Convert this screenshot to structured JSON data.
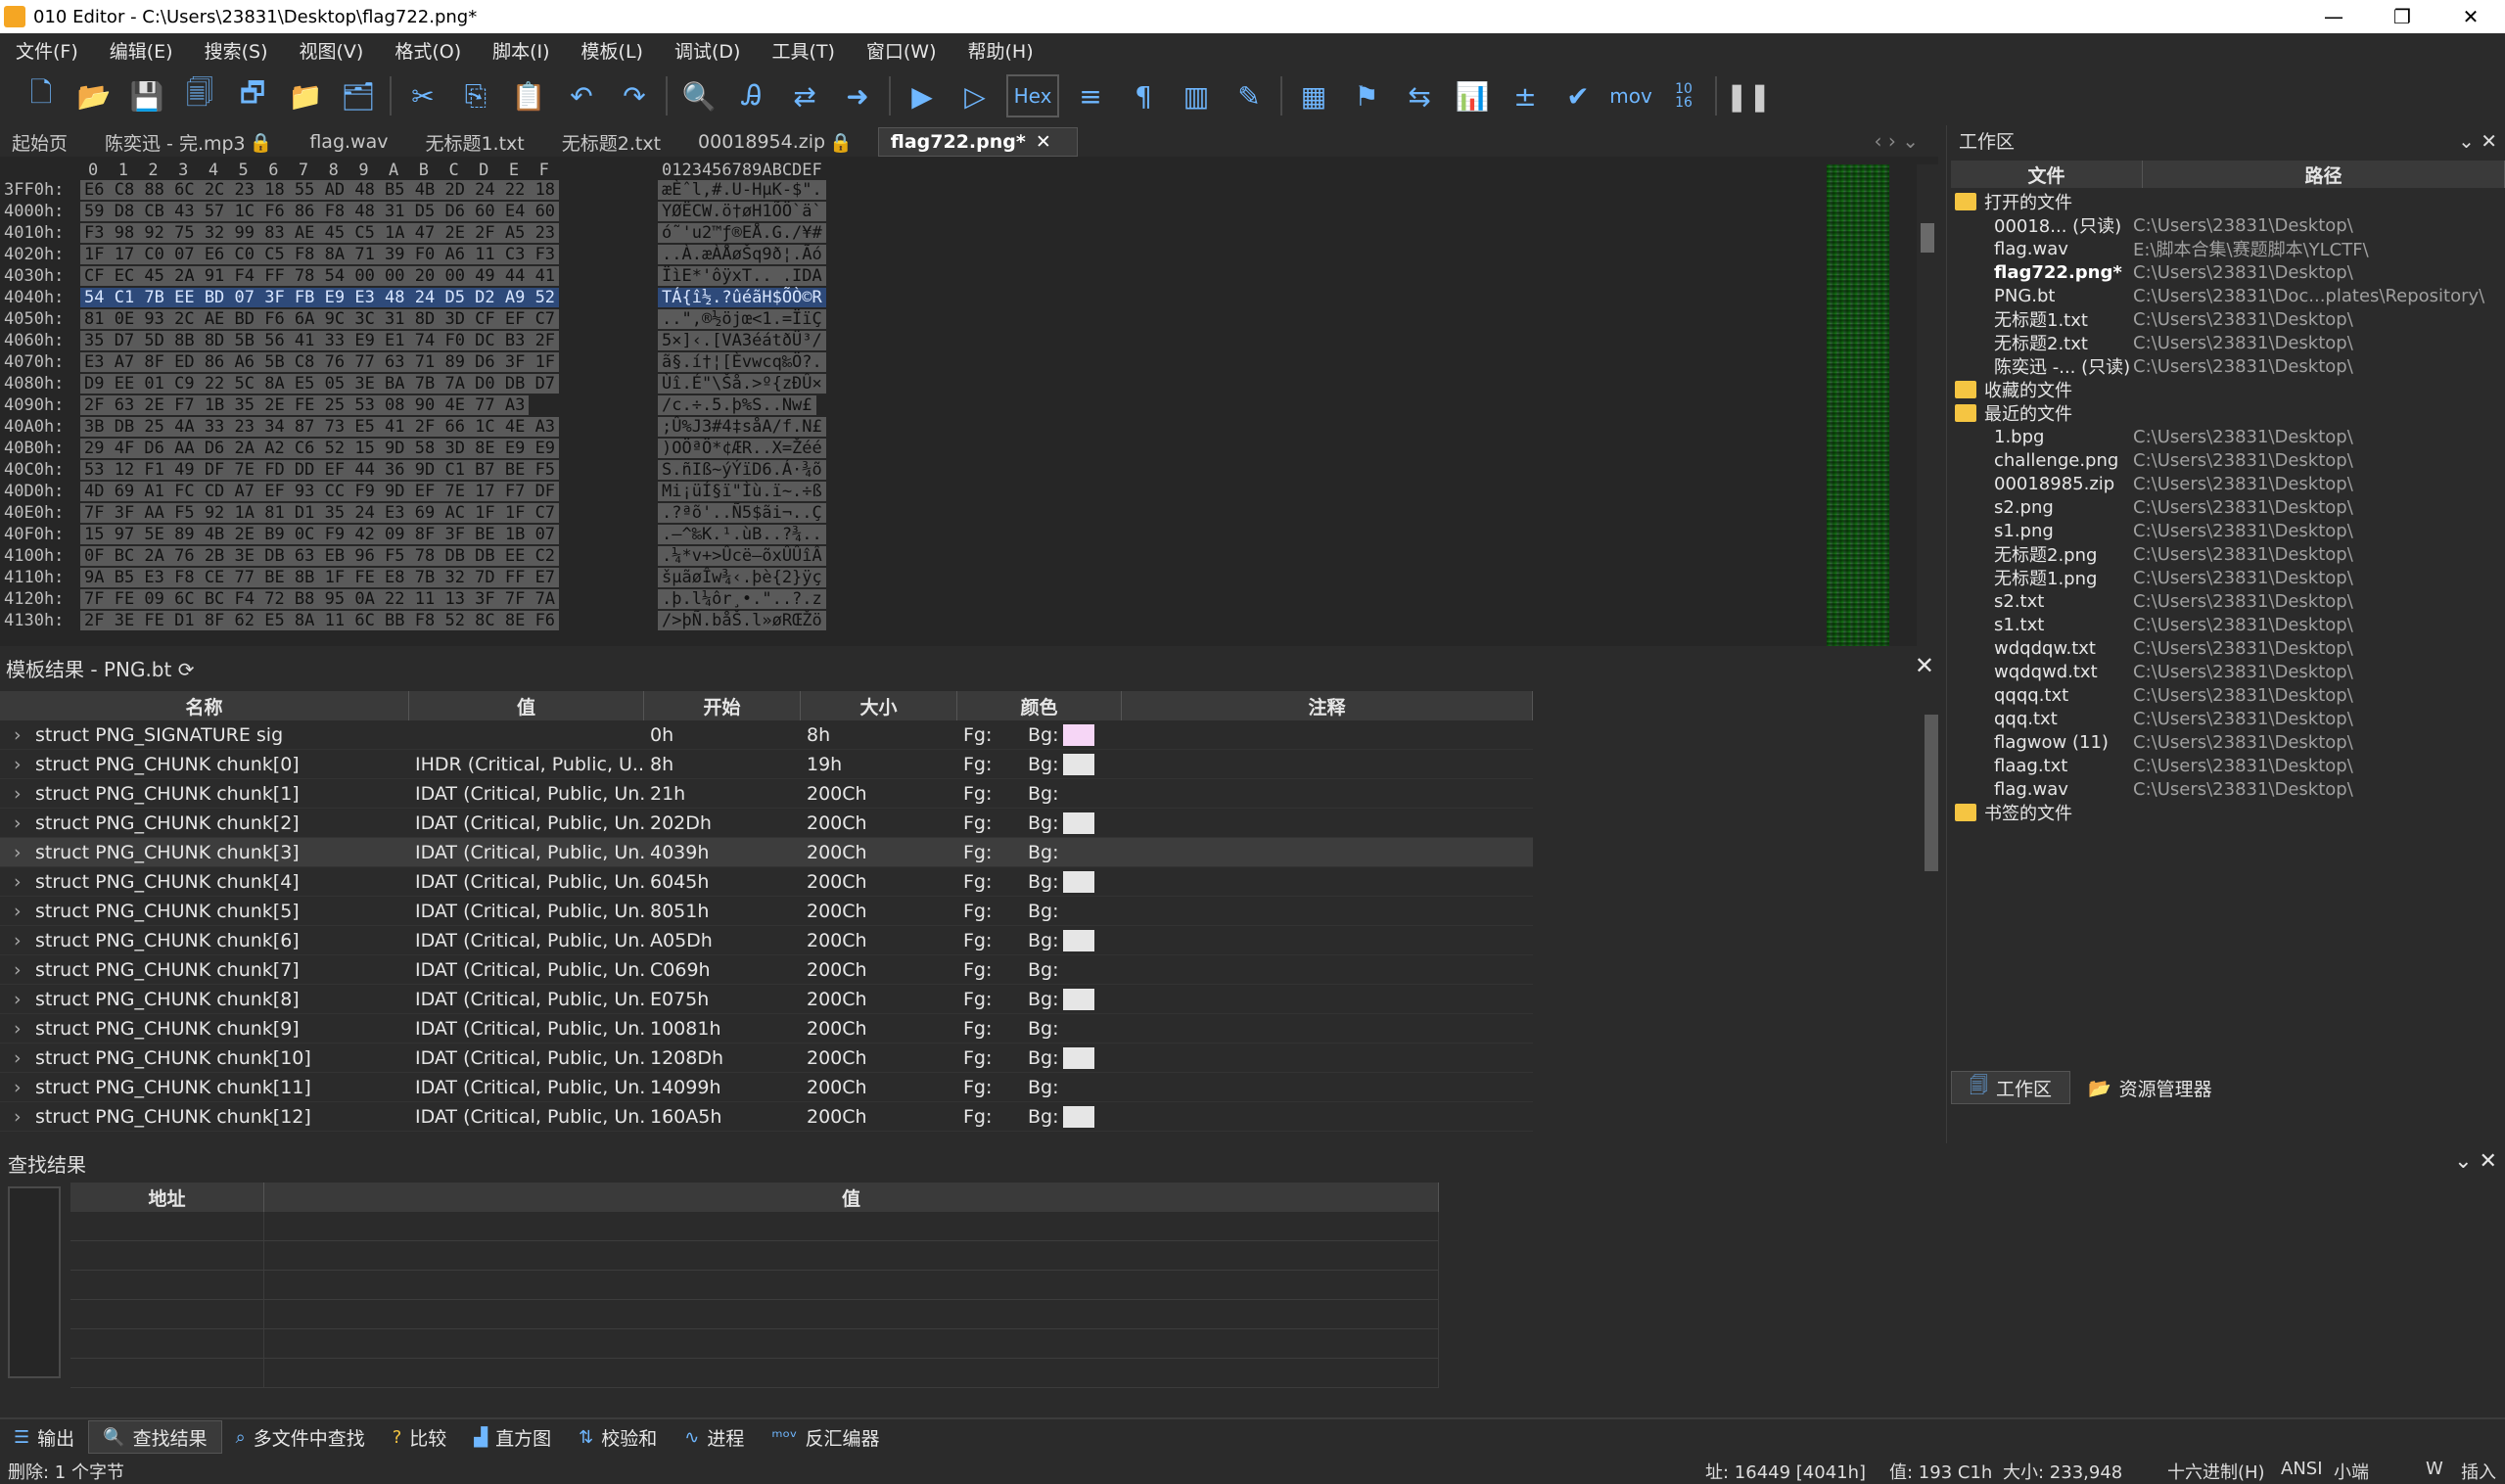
{
  "window": {
    "title": "010 Editor - C:\\Users\\23831\\Desktop\\flag722.png*",
    "min": "—",
    "max": "❐",
    "close": "✕"
  },
  "menu": [
    "文件(F)",
    "编辑(E)",
    "搜索(S)",
    "视图(V)",
    "格式(O)",
    "脚本(I)",
    "模板(L)",
    "调试(D)",
    "工具(T)",
    "窗口(W)",
    "帮助(H)"
  ],
  "toolbar": {
    "hex_label": "Hex",
    "mov_label": "mov",
    "base_label": "10\n16"
  },
  "tabs": [
    {
      "label": "起始页"
    },
    {
      "label": "陈奕迅 - 完.mp3"
    },
    {
      "label": "flag.wav"
    },
    {
      "label": "无标题1.txt"
    },
    {
      "label": "无标题2.txt"
    },
    {
      "label": "00018954.zip"
    },
    {
      "label": "flag722.png*",
      "close": "✕"
    }
  ],
  "hex": {
    "col_header": "0  1  2  3  4  5  6  7  8  9  A  B  C  D  E  F",
    "ascii_header": "0123456789ABCDEF",
    "rows": [
      {
        "addr": "3FF0h:",
        "bytes": "E6 C8 88 6C 2C 23 18 55 AD 48 B5 4B 2D 24 22 18",
        "ascii": "æÈˆl,#.U-HµK-$\"."
      },
      {
        "addr": "4000h:",
        "bytes": "59 D8 CB 43 57 1C F6 86 F8 48 31 D5 D6 60 E4 60",
        "ascii": "YØËCW.ö†øH1ÕÖ`ä`"
      },
      {
        "addr": "4010h:",
        "bytes": "F3 98 92 75 32 99 83 AE 45 C5 1A 47 2E 2F A5 23",
        "ascii": "ó˜'u2™ƒ®EÅ.G./¥#"
      },
      {
        "addr": "4020h:",
        "bytes": "1F 17 C0 07 E6 C0 C5 F8 8A 71 39 F0 A6 11 C3 F3",
        "ascii": "..À.æÀÅøŠq9ð¦.Ãó"
      },
      {
        "addr": "4030h:",
        "bytes": "CF EC 45 2A 91 F4 FF 78 54 00 00 20 00 49 44 41",
        "ascii": "ÏìE*'ôÿxT.. .IDA"
      },
      {
        "addr": "4040h:",
        "bytes": "54 C1 7B EE BD 07 3F FB E9 E3 48 24 D5 D2 A9 52",
        "ascii": "TÁ{î½.?ûéãH$ÕÒ©R",
        "sel": true
      },
      {
        "addr": "4050h:",
        "bytes": "81 0E 93 2C AE BD F6 6A 9C 3C 31 8D 3D CF EF C7",
        "ascii": "..\",®½öjœ<1.=ÏïÇ"
      },
      {
        "addr": "4060h:",
        "bytes": "35 D7 5D 8B 8D 5B 56 41 33 E9 E1 74 F0 DC B3 2F",
        "ascii": "5×]‹.[VA3éátðÜ³/"
      },
      {
        "addr": "4070h:",
        "bytes": "E3 A7 8F ED 86 A6 5B C8 76 77 63 71 89 D6 3F 1F",
        "ascii": "ã§.í†¦[Èvwcq‰Ö?."
      },
      {
        "addr": "4080h:",
        "bytes": "D9 EE 01 C9 22 5C 8A E5 05 3E BA 7B 7A D0 DB D7",
        "ascii": "Ùî.É\"\\Šå.>º{zÐÛ×"
      },
      {
        "addr": "4090h:",
        "bytes": "2F 63 2E F7 1B 35 2E FE 25 53 08 90 4E 77 A3",
        "ascii": "/c.÷.5.þ%S..Nw£"
      },
      {
        "addr": "40A0h:",
        "bytes": "3B DB 25 4A 33 23 34 87 73 E5 41 2F 66 1C 4E A3",
        "ascii": ";Û%J3#4‡såA/f.N£"
      },
      {
        "addr": "40B0h:",
        "bytes": "29 4F D6 AA D6 2A A2 C6 52 15 9D 58 3D 8E E9 E9",
        "ascii": ")OÖªÖ*¢ÆR..X=Žéé"
      },
      {
        "addr": "40C0h:",
        "bytes": "53 12 F1 49 DF 7E FD DD EF 44 36 9D C1 B7 BE F5",
        "ascii": "S.ñIß~ýÝïD6.Á·¾õ"
      },
      {
        "addr": "40D0h:",
        "bytes": "4D 69 A1 FC CD A7 EF 93 CC F9 9D EF 7E 17 F7 DF",
        "ascii": "Mi¡üÍ§ï\"Ìù.ï~.÷ß"
      },
      {
        "addr": "40E0h:",
        "bytes": "7F 3F AA F5 92 1A 81 D1 35 24 E3 69 AC 1F 1F C7",
        "ascii": ".?ªõ'..Ñ5$ãi¬..Ç"
      },
      {
        "addr": "40F0h:",
        "bytes": "15 97 5E 89 4B 2E B9 0C F9 42 09 8F 3F BE 1B 07",
        "ascii": ".—^‰K.¹.ùB..?¾.."
      },
      {
        "addr": "4100h:",
        "bytes": "0F BC 2A 76 2B 3E DB 63 EB 96 F5 78 DB DB EE C2",
        "ascii": ".¼*v+>Ûcë–õxÛÛîÂ"
      },
      {
        "addr": "4110h:",
        "bytes": "9A B5 E3 F8 CE 77 BE 8B 1F FE E8 7B 32 7D FF E7",
        "ascii": "šµãøÎw¾‹.þè{2}ÿç"
      },
      {
        "addr": "4120h:",
        "bytes": "7F FE 09 6C BC F4 72 B8 95 0A 22 11 13 3F 7F 7A",
        "ascii": ".þ.l¼ôr¸•.\"..?.z"
      },
      {
        "addr": "4130h:",
        "bytes": "2F 3E FE D1 8F 62 E5 8A 11 6C BB F8 52 8C 8E F6",
        "ascii": "/>þÑ.båŠ.l»øRŒŽö"
      }
    ]
  },
  "template": {
    "title": "模板结果 - PNG.bt",
    "columns": [
      "名称",
      "值",
      "开始",
      "大小",
      "颜色",
      "注释"
    ],
    "rows": [
      {
        "name": "struct PNG_SIGNATURE sig",
        "value": "",
        "start": "0h",
        "size": "8h",
        "fg": "Fg:",
        "bg": "Bg:",
        "swatch": "#f6d6f6"
      },
      {
        "name": "struct PNG_CHUNK chunk[0]",
        "value": "IHDR  (Critical, Public, U...",
        "start": "8h",
        "size": "19h",
        "fg": "Fg:",
        "bg": "Bg:",
        "swatch": "#e6e6e6"
      },
      {
        "name": "struct PNG_CHUNK chunk[1]",
        "value": "IDAT  (Critical, Public, Un...",
        "start": "21h",
        "size": "200Ch",
        "fg": "Fg:",
        "bg": "Bg:",
        "swatch": ""
      },
      {
        "name": "struct PNG_CHUNK chunk[2]",
        "value": "IDAT  (Critical, Public, Un...",
        "start": "202Dh",
        "size": "200Ch",
        "fg": "Fg:",
        "bg": "Bg:",
        "swatch": "#e6e6e6"
      },
      {
        "name": "struct PNG_CHUNK chunk[3]",
        "value": "IDAT  (Critical, Public, Un...",
        "start": "4039h",
        "size": "200Ch",
        "fg": "Fg:",
        "bg": "Bg:",
        "swatch": "",
        "hl": true
      },
      {
        "name": "struct PNG_CHUNK chunk[4]",
        "value": "IDAT  (Critical, Public, Un...",
        "start": "6045h",
        "size": "200Ch",
        "fg": "Fg:",
        "bg": "Bg:",
        "swatch": "#e6e6e6"
      },
      {
        "name": "struct PNG_CHUNK chunk[5]",
        "value": "IDAT  (Critical, Public, Un...",
        "start": "8051h",
        "size": "200Ch",
        "fg": "Fg:",
        "bg": "Bg:",
        "swatch": ""
      },
      {
        "name": "struct PNG_CHUNK chunk[6]",
        "value": "IDAT  (Critical, Public, Un...",
        "start": "A05Dh",
        "size": "200Ch",
        "fg": "Fg:",
        "bg": "Bg:",
        "swatch": "#e6e6e6"
      },
      {
        "name": "struct PNG_CHUNK chunk[7]",
        "value": "IDAT  (Critical, Public, Un...",
        "start": "C069h",
        "size": "200Ch",
        "fg": "Fg:",
        "bg": "Bg:",
        "swatch": ""
      },
      {
        "name": "struct PNG_CHUNK chunk[8]",
        "value": "IDAT  (Critical, Public, Un...",
        "start": "E075h",
        "size": "200Ch",
        "fg": "Fg:",
        "bg": "Bg:",
        "swatch": "#e6e6e6"
      },
      {
        "name": "struct PNG_CHUNK chunk[9]",
        "value": "IDAT  (Critical, Public, Un...",
        "start": "10081h",
        "size": "200Ch",
        "fg": "Fg:",
        "bg": "Bg:",
        "swatch": ""
      },
      {
        "name": "struct PNG_CHUNK chunk[10]",
        "value": "IDAT  (Critical, Public, Un...",
        "start": "1208Dh",
        "size": "200Ch",
        "fg": "Fg:",
        "bg": "Bg:",
        "swatch": "#e6e6e6"
      },
      {
        "name": "struct PNG_CHUNK chunk[11]",
        "value": "IDAT  (Critical, Public, Un...",
        "start": "14099h",
        "size": "200Ch",
        "fg": "Fg:",
        "bg": "Bg:",
        "swatch": ""
      },
      {
        "name": "struct PNG_CHUNK chunk[12]",
        "value": "IDAT  (Critical, Public, Un...",
        "start": "160A5h",
        "size": "200Ch",
        "fg": "Fg:",
        "bg": "Bg:",
        "swatch": "#e6e6e6"
      }
    ]
  },
  "workspace": {
    "title": "工作区",
    "columns": [
      "文件",
      "路径"
    ],
    "open_files_label": "打开的文件",
    "open_files": [
      {
        "name": "00018... (只读)",
        "path": "C:\\Users\\23831\\Desktop\\"
      },
      {
        "name": "flag.wav",
        "path": "E:\\脚本合集\\赛题脚本\\YLCTF\\"
      },
      {
        "name": "flag722.png*",
        "path": "C:\\Users\\23831\\Desktop\\",
        "bold": true
      },
      {
        "name": "PNG.bt",
        "path": "C:\\Users\\23831\\Doc...plates\\Repository\\"
      },
      {
        "name": "无标题1.txt",
        "path": "C:\\Users\\23831\\Desktop\\"
      },
      {
        "name": "无标题2.txt",
        "path": "C:\\Users\\23831\\Desktop\\"
      },
      {
        "name": "陈奕迅 -... (只读)",
        "path": "C:\\Users\\23831\\Desktop\\"
      }
    ],
    "favorites_label": "收藏的文件",
    "recent_label": "最近的文件",
    "recent_files": [
      {
        "name": "1.bpg",
        "path": "C:\\Users\\23831\\Desktop\\"
      },
      {
        "name": "challenge.png",
        "path": "C:\\Users\\23831\\Desktop\\"
      },
      {
        "name": "00018985.zip",
        "path": "C:\\Users\\23831\\Desktop\\"
      },
      {
        "name": "s2.png",
        "path": "C:\\Users\\23831\\Desktop\\"
      },
      {
        "name": "s1.png",
        "path": "C:\\Users\\23831\\Desktop\\"
      },
      {
        "name": "无标题2.png",
        "path": "C:\\Users\\23831\\Desktop\\"
      },
      {
        "name": "无标题1.png",
        "path": "C:\\Users\\23831\\Desktop\\"
      },
      {
        "name": "s2.txt",
        "path": "C:\\Users\\23831\\Desktop\\"
      },
      {
        "name": "s1.txt",
        "path": "C:\\Users\\23831\\Desktop\\"
      },
      {
        "name": "wdqdqw.txt",
        "path": "C:\\Users\\23831\\Desktop\\"
      },
      {
        "name": "wqdqwd.txt",
        "path": "C:\\Users\\23831\\Desktop\\"
      },
      {
        "name": "qqqq.txt",
        "path": "C:\\Users\\23831\\Desktop\\"
      },
      {
        "name": "qqq.txt",
        "path": "C:\\Users\\23831\\Desktop\\"
      },
      {
        "name": "flagwow (11)",
        "path": "C:\\Users\\23831\\Desktop\\"
      },
      {
        "name": "flaag.txt",
        "path": "C:\\Users\\23831\\Desktop\\"
      },
      {
        "name": "flag.wav",
        "path": "C:\\Users\\23831\\Desktop\\"
      }
    ],
    "bookmarks_label": "书签的文件",
    "tab_workspace": "工作区",
    "tab_explorer": "资源管理器"
  },
  "find": {
    "title": "查找结果",
    "columns": [
      "地址",
      "值"
    ]
  },
  "bottom_tabs": [
    "输出",
    "查找结果",
    "多文件中查找",
    "比较",
    "直方图",
    "校验和",
    "进程",
    "反汇编器"
  ],
  "status": {
    "left": "删除: 1 个字节",
    "addr": "址: 16449 [4041h]",
    "value": "值: 193 C1h",
    "size": "大小: 233,948",
    "mode": "十六进制(H)",
    "enc": "ANSI",
    "endian": "小端",
    "w": "W",
    "ins": "插入"
  }
}
